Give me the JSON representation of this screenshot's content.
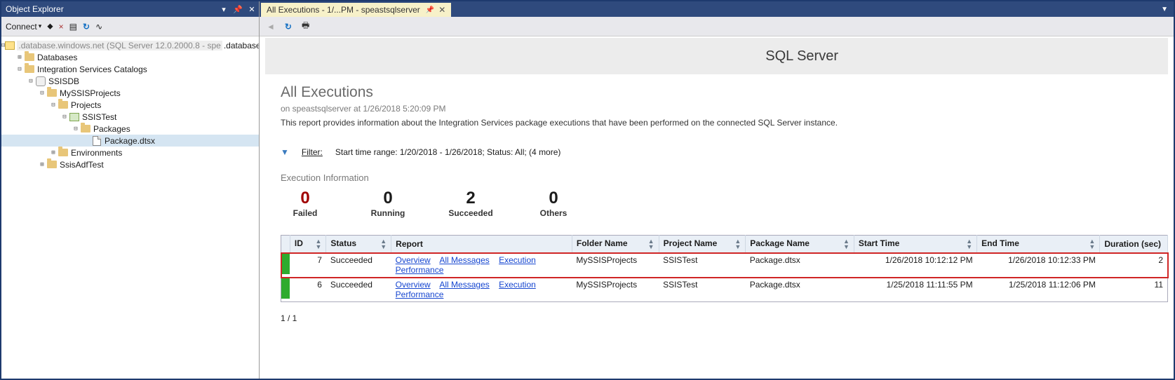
{
  "object_explorer": {
    "title": "Object Explorer",
    "connect_label": "Connect",
    "server_node": ".database.windows.net (SQL Server 12.0.2000.8 - spe",
    "nodes": {
      "databases": "Databases",
      "isc": "Integration Services Catalogs",
      "ssisdb": "SSISDB",
      "myssisprojects": "MySSISProjects",
      "projects": "Projects",
      "ssistest": "SSISTest",
      "packages": "Packages",
      "package_dtsx": "Package.dtsx",
      "environments": "Environments",
      "ssisadftest": "SsisAdfTest"
    }
  },
  "tab": {
    "label": "All Executions - 1/...PM - speastsqlserver"
  },
  "report": {
    "brand": "SQL Server",
    "title": "All Executions",
    "subtitle": "on speastsqlserver at 1/26/2018 5:20:09 PM",
    "description": "This report provides information about the Integration Services package executions that have been performed on the connected SQL Server instance.",
    "filter_label": "Filter:",
    "filter_text": "Start time range: 1/20/2018 - 1/26/2018;  Status: All;  (4 more)",
    "exec_info_label": "Execution Information",
    "counters": {
      "failed": {
        "num": "0",
        "label": "Failed"
      },
      "running": {
        "num": "0",
        "label": "Running"
      },
      "succeeded": {
        "num": "2",
        "label": "Succeeded"
      },
      "others": {
        "num": "0",
        "label": "Others"
      }
    },
    "columns": {
      "id": "ID",
      "status": "Status",
      "report": "Report",
      "folder": "Folder Name",
      "project": "Project Name",
      "package": "Package Name",
      "start": "Start Time",
      "end": "End Time",
      "duration": "Duration (sec)"
    },
    "links": {
      "overview": "Overview",
      "all_messages": "All Messages",
      "exec_perf": "Execution Performance"
    },
    "rows": [
      {
        "id": "7",
        "status": "Succeeded",
        "folder": "MySSISProjects",
        "project": "SSISTest",
        "package": "Package.dtsx",
        "start": "1/26/2018 10:12:12 PM",
        "end": "1/26/2018 10:12:33 PM",
        "duration": "2"
      },
      {
        "id": "6",
        "status": "Succeeded",
        "folder": "MySSISProjects",
        "project": "SSISTest",
        "package": "Package.dtsx",
        "start": "1/25/2018 11:11:55 PM",
        "end": "1/25/2018 11:12:06 PM",
        "duration": "11"
      }
    ],
    "pager": "1 / 1"
  },
  "chart_data": {
    "type": "table",
    "title": "All Executions",
    "columns": [
      "ID",
      "Status",
      "Folder Name",
      "Project Name",
      "Package Name",
      "Start Time",
      "End Time",
      "Duration (sec)"
    ],
    "rows": [
      [
        7,
        "Succeeded",
        "MySSISProjects",
        "SSISTest",
        "Package.dtsx",
        "1/26/2018 10:12:12 PM",
        "1/26/2018 10:12:33 PM",
        2
      ],
      [
        6,
        "Succeeded",
        "MySSISProjects",
        "SSISTest",
        "Package.dtsx",
        "1/25/2018 11:11:55 PM",
        "1/25/2018 11:12:06 PM",
        11
      ]
    ],
    "summary": {
      "Failed": 0,
      "Running": 0,
      "Succeeded": 2,
      "Others": 0
    }
  }
}
